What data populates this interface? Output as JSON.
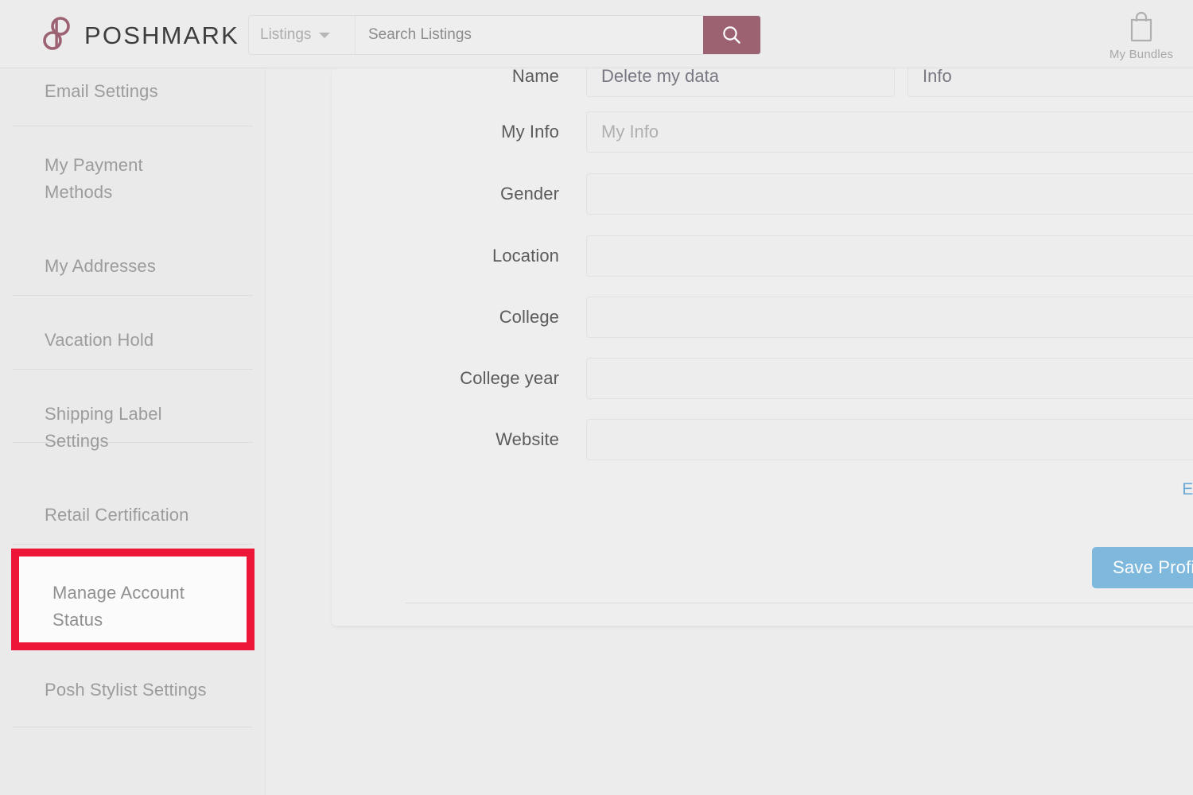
{
  "brand": {
    "name": "POSHMARK",
    "logo_color": "#9c6272",
    "accent_red": "#ED1639",
    "link_blue": "#6aa9d8",
    "button_blue": "#7fb8dd"
  },
  "header": {
    "search": {
      "category_label": "Listings",
      "category_icon": "chevron-down-icon",
      "input_value": "",
      "placeholder": "Search Listings",
      "submit_icon": "search-icon"
    },
    "bundles": {
      "icon": "shopping-bag-icon",
      "label": "My Bundles"
    }
  },
  "sidebar": {
    "items": [
      {
        "label": "Email Settings",
        "selected": false
      },
      {
        "label": "My Payment Methods",
        "selected": false
      },
      {
        "label": "My Addresses",
        "selected": false
      },
      {
        "label": "Vacation Hold",
        "selected": false
      },
      {
        "label": "Shipping Label Settings",
        "selected": false
      },
      {
        "label": "Retail Certification",
        "selected": false
      },
      {
        "label": "Manage Account Status",
        "selected": true
      },
      {
        "label": "Posh Stylist Settings",
        "selected": false
      }
    ],
    "highlighted_label": "Manage Account Status"
  },
  "main": {
    "fields": [
      {
        "label": "Name",
        "value": "Delete my data",
        "placeholder": ""
      },
      {
        "label": "Info",
        "value": "Info",
        "placeholder": ""
      },
      {
        "label": "My Info",
        "value": "",
        "placeholder": "My Info"
      },
      {
        "label": "Gender",
        "value": "",
        "placeholder": ""
      },
      {
        "label": "Location",
        "value": "",
        "placeholder": ""
      },
      {
        "label": "College",
        "value": "",
        "placeholder": ""
      },
      {
        "label": "College year",
        "value": "",
        "placeholder": ""
      },
      {
        "label": "Website",
        "value": "",
        "placeholder": ""
      }
    ],
    "edit_link_label": "Edit My",
    "save_button_label": "Save Profi"
  }
}
